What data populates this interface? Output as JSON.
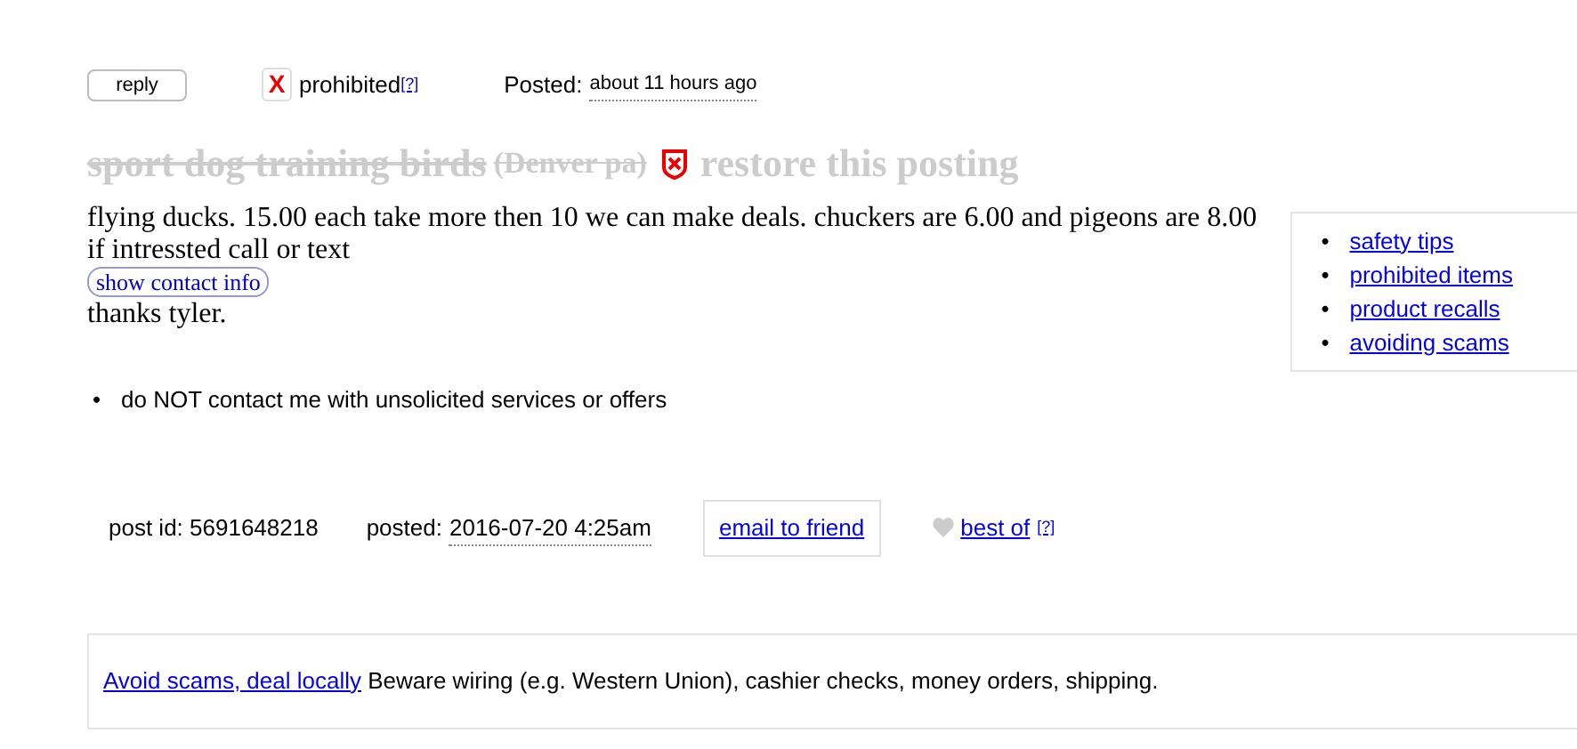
{
  "actions": {
    "reply": "reply",
    "flag_mark": "X",
    "flag_label": "prohibited",
    "flag_help": "[?]",
    "posted_label": "Posted:",
    "posted_value": "about 11 hours ago"
  },
  "title": {
    "text": "sport dog training birds",
    "location": "(Denver pa)",
    "deleted": true,
    "restore": "restore this posting"
  },
  "body": {
    "lines": [
      "flying ducks. 15.00 each take more then 10 we can make deals. chuckers are 6.00 and pigeons are 8.00",
      "if intressted call or text"
    ],
    "contact_button": "show contact info",
    "closing": "thanks tyler."
  },
  "notices": [
    {
      "bullet": "•",
      "text": "do NOT contact me with unsolicited services or offers"
    }
  ],
  "sidebar": {
    "links": [
      {
        "bullet": "•",
        "label": "safety tips"
      },
      {
        "bullet": "•",
        "label": "prohibited items"
      },
      {
        "bullet": "•",
        "label": "product recalls"
      },
      {
        "bullet": "•",
        "label": "avoiding scams"
      }
    ]
  },
  "info": {
    "post_id": "post id: 5691648218",
    "posted_label": "posted:",
    "posted_value": "2016-07-20 4:25am",
    "email": "email to friend",
    "best_of": "best of",
    "best_help": "[?]"
  },
  "footer": {
    "link": "Avoid scams, deal locally",
    "text": "Beware wiring (e.g. Western Union), cashier checks, money orders, shipping."
  }
}
